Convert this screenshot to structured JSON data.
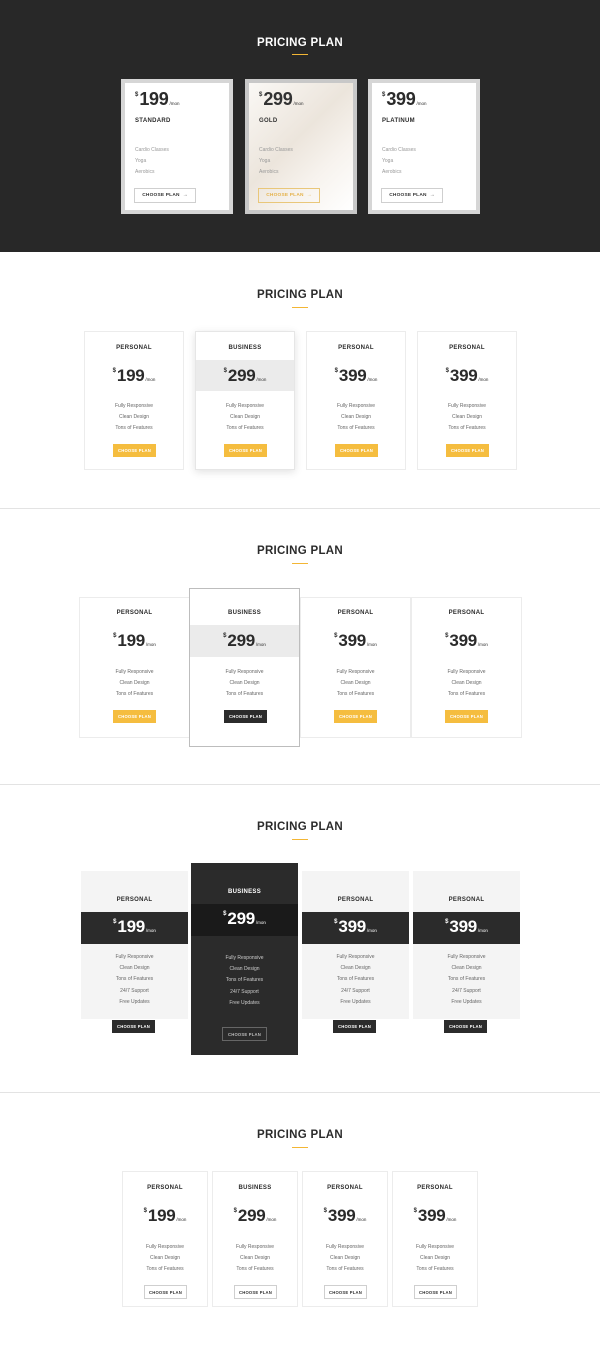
{
  "s1": {
    "title": "PRICING PLAN",
    "cards": [
      {
        "currency": "$",
        "price": "199",
        "period": "/mon",
        "name": "STANDARD",
        "features": [
          "Cardio Classes",
          "Yoga",
          "Aerobics"
        ],
        "button": "CHOOSE PLAN",
        "arrow": "→"
      },
      {
        "currency": "$",
        "price": "299",
        "period": "/mon",
        "name": "GOLD",
        "features": [
          "Cardio Classes",
          "Yoga",
          "Aerobics"
        ],
        "button": "CHOOSE PLAN",
        "arrow": "→"
      },
      {
        "currency": "$",
        "price": "399",
        "period": "/mon",
        "name": "PLATINUM",
        "features": [
          "Cardio Classes",
          "Yoga",
          "Aerobics"
        ],
        "button": "CHOOSE PLAN",
        "arrow": "→"
      }
    ]
  },
  "s2": {
    "title": "PRICING PLAN",
    "cards": [
      {
        "name": "PERSONAL",
        "currency": "$",
        "price": "199",
        "period": "/mon",
        "features": [
          "Fully Responsive",
          "Clean Design",
          "Tons of Features"
        ],
        "button": "CHOOSE PLAN"
      },
      {
        "name": "BUSINESS",
        "currency": "$",
        "price": "299",
        "period": "/mon",
        "features": [
          "Fully Responsive",
          "Clean Design",
          "Tons of Features"
        ],
        "button": "CHOOSE PLAN"
      },
      {
        "name": "PERSONAL",
        "currency": "$",
        "price": "399",
        "period": "/mon",
        "features": [
          "Fully Responsive",
          "Clean Design",
          "Tons of Features"
        ],
        "button": "CHOOSE PLAN"
      },
      {
        "name": "PERSONAL",
        "currency": "$",
        "price": "399",
        "period": "/mon",
        "features": [
          "Fully Responsive",
          "Clean Design",
          "Tons of Features"
        ],
        "button": "CHOOSE PLAN"
      }
    ]
  },
  "s3": {
    "title": "PRICING PLAN",
    "cards": [
      {
        "name": "PERSONAL",
        "currency": "$",
        "price": "199",
        "period": "/mon",
        "features": [
          "Fully Responsive",
          "Clean Design",
          "Tons of Features"
        ],
        "button": "CHOOSE PLAN"
      },
      {
        "name": "BUSINESS",
        "currency": "$",
        "price": "299",
        "period": "/mon",
        "features": [
          "Fully Responsive",
          "Clean Design",
          "Tons of Features"
        ],
        "button": "CHOOSE PLAN"
      },
      {
        "name": "PERSONAL",
        "currency": "$",
        "price": "399",
        "period": "/mon",
        "features": [
          "Fully Responsive",
          "Clean Design",
          "Tons of Features"
        ],
        "button": "CHOOSE PLAN"
      },
      {
        "name": "PERSONAL",
        "currency": "$",
        "price": "399",
        "period": "/mon",
        "features": [
          "Fully Responsive",
          "Clean Design",
          "Tons of Features"
        ],
        "button": "CHOOSE PLAN"
      }
    ]
  },
  "s4": {
    "title": "PRICING PLAN",
    "cards": [
      {
        "name": "PERSONAL",
        "currency": "$",
        "price": "199",
        "period": "/mon",
        "features": [
          "Fully Responsive",
          "Clean Design",
          "Tons of Features",
          "24/7 Support",
          "Free Updates"
        ],
        "button": "CHOOSE PLAN"
      },
      {
        "name": "BUSINESS",
        "currency": "$",
        "price": "299",
        "period": "/mon",
        "features": [
          "Fully Responsive",
          "Clean Design",
          "Tons of Features",
          "24/7 Support",
          "Free Updates"
        ],
        "button": "CHOOSE PLAN"
      },
      {
        "name": "PERSONAL",
        "currency": "$",
        "price": "399",
        "period": "/mon",
        "features": [
          "Fully Responsive",
          "Clean Design",
          "Tons of Features",
          "24/7 Support",
          "Free Updates"
        ],
        "button": "CHOOSE PLAN"
      },
      {
        "name": "PERSONAL",
        "currency": "$",
        "price": "399",
        "period": "/mon",
        "features": [
          "Fully Responsive",
          "Clean Design",
          "Tons of Features",
          "24/7 Support",
          "Free Updates"
        ],
        "button": "CHOOSE PLAN"
      }
    ]
  },
  "s5": {
    "title": "PRICING PLAN",
    "cards": [
      {
        "name": "PERSONAL",
        "currency": "$",
        "price": "199",
        "period": "/mon",
        "features": [
          "Fully Responsive",
          "Clean Design",
          "Tons of Features"
        ],
        "button": "CHOOSE PLAN"
      },
      {
        "name": "BUSINESS",
        "currency": "$",
        "price": "299",
        "period": "/mon",
        "features": [
          "Fully Responsive",
          "Clean Design",
          "Tons of Features"
        ],
        "button": "CHOOSE PLAN"
      },
      {
        "name": "PERSONAL",
        "currency": "$",
        "price": "399",
        "period": "/mon",
        "features": [
          "Fully Responsive",
          "Clean Design",
          "Tons of Features"
        ],
        "button": "CHOOSE PLAN"
      },
      {
        "name": "PERSONAL",
        "currency": "$",
        "price": "399",
        "period": "/mon",
        "features": [
          "Fully Responsive",
          "Clean Design",
          "Tons of Features"
        ],
        "button": "CHOOSE PLAN"
      }
    ]
  },
  "colors": {
    "accent": "#f5bd3f",
    "dark": "#2b2b2b",
    "hero_bg": "#282828"
  }
}
